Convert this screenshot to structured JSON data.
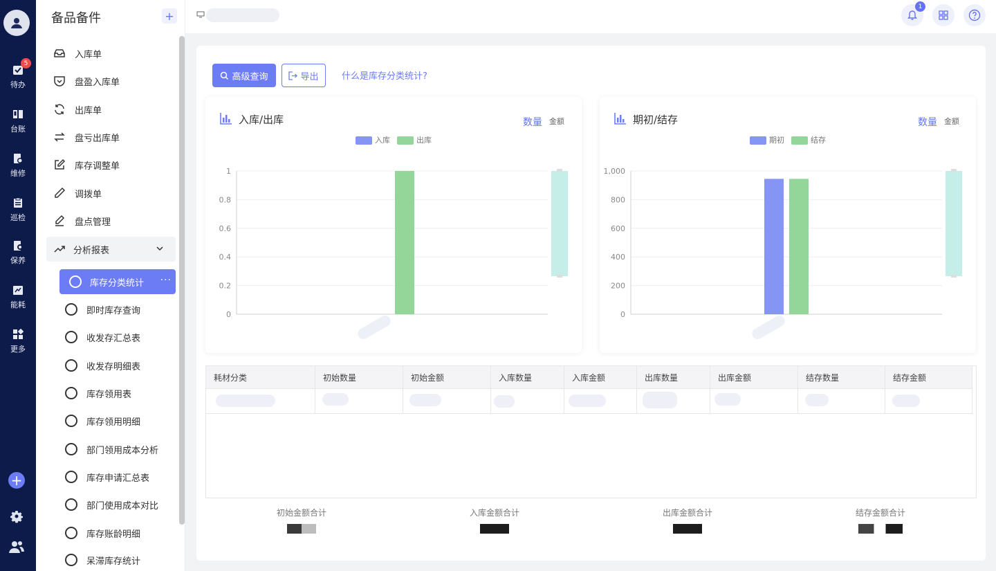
{
  "rail": {
    "todo_badge": "5",
    "items": [
      {
        "label": "待办",
        "icon": "todo-icon"
      },
      {
        "label": "台账",
        "icon": "ledger-icon"
      },
      {
        "label": "维修",
        "icon": "repair-icon"
      },
      {
        "label": "巡检",
        "icon": "inspection-icon"
      },
      {
        "label": "保养",
        "icon": "maintenance-icon"
      },
      {
        "label": "能耗",
        "icon": "energy-icon"
      },
      {
        "label": "更多",
        "icon": "more-icon"
      }
    ],
    "add_label": "+"
  },
  "sidebar": {
    "title": "备品备件",
    "add_label": "+",
    "items": [
      {
        "label": "入库单",
        "icon": "inbox-icon"
      },
      {
        "label": "盘盈入库单",
        "icon": "pocket-icon"
      },
      {
        "label": "出库单",
        "icon": "refresh-icon"
      },
      {
        "label": "盘亏出库单",
        "icon": "swap-icon"
      },
      {
        "label": "库存调整单",
        "icon": "edit-icon"
      },
      {
        "label": "调拨单",
        "icon": "pen-icon"
      },
      {
        "label": "盘点管理",
        "icon": "pencil-icon"
      }
    ],
    "group": {
      "label": "分析报表",
      "icon": "trending-up-icon"
    },
    "active_sub": "库存分类统计",
    "more_label": "···",
    "sub_items": [
      "即时库存查询",
      "收发存汇总表",
      "收发存明细表",
      "库存领用表",
      "库存领用明细",
      "部门领用成本分析",
      "库存申请汇总表",
      "部门使用成本对比",
      "库存账龄明细",
      "呆滞库存统计"
    ]
  },
  "topbar": {
    "notification_count": "1"
  },
  "toolbar": {
    "search_label": "高级查询",
    "export_label": "导出",
    "help_link": "什么是库存分类统计?"
  },
  "cards": {
    "left": {
      "title": "入库/出库",
      "toggle_on": "数量",
      "toggle_off": "金额"
    },
    "right": {
      "title": "期初/结存",
      "toggle_on": "数量",
      "toggle_off": "金额"
    }
  },
  "chart_data": [
    {
      "type": "bar",
      "title": "入库/出库",
      "categories": [
        ""
      ],
      "series": [
        {
          "name": "入库",
          "values": [
            0
          ],
          "color": "#8595f3"
        },
        {
          "name": "出库",
          "values": [
            1
          ],
          "color": "#94d59a"
        }
      ],
      "ylim": [
        0,
        1
      ],
      "yticks": [
        0,
        0.2,
        0.4,
        0.6,
        0.8,
        1
      ],
      "ytick_labels": [
        "0",
        "0.2",
        "0.4",
        "0.6",
        "0.8",
        "1"
      ],
      "legend": "top-center",
      "grid": true
    },
    {
      "type": "bar",
      "title": "期初/结存",
      "categories": [
        ""
      ],
      "series": [
        {
          "name": "期初",
          "values": [
            945
          ],
          "color": "#8595f3"
        },
        {
          "name": "结存",
          "values": [
            945
          ],
          "color": "#94d59a"
        }
      ],
      "ylim": [
        0,
        1000
      ],
      "yticks": [
        0,
        200,
        400,
        600,
        800,
        1000
      ],
      "ytick_labels": [
        "0",
        "200",
        "400",
        "600",
        "800",
        "1,000"
      ],
      "legend": "top-center",
      "grid": true
    }
  ],
  "table": {
    "columns": [
      "耗材分类",
      "初始数量",
      "初始金额",
      "入库数量",
      "入库金额",
      "出库数量",
      "出库金额",
      "结存数量",
      "结存金额"
    ]
  },
  "totals": [
    "初始金额合计",
    "入库金额合计",
    "出库金额合计",
    "结存金额合计"
  ],
  "colors": {
    "accent": "#6c7cf5",
    "rail_bg": "#0d1b4b",
    "bar_blue": "#8595f3",
    "bar_green": "#94d59a",
    "zoom_slider": "#c5eee9"
  }
}
